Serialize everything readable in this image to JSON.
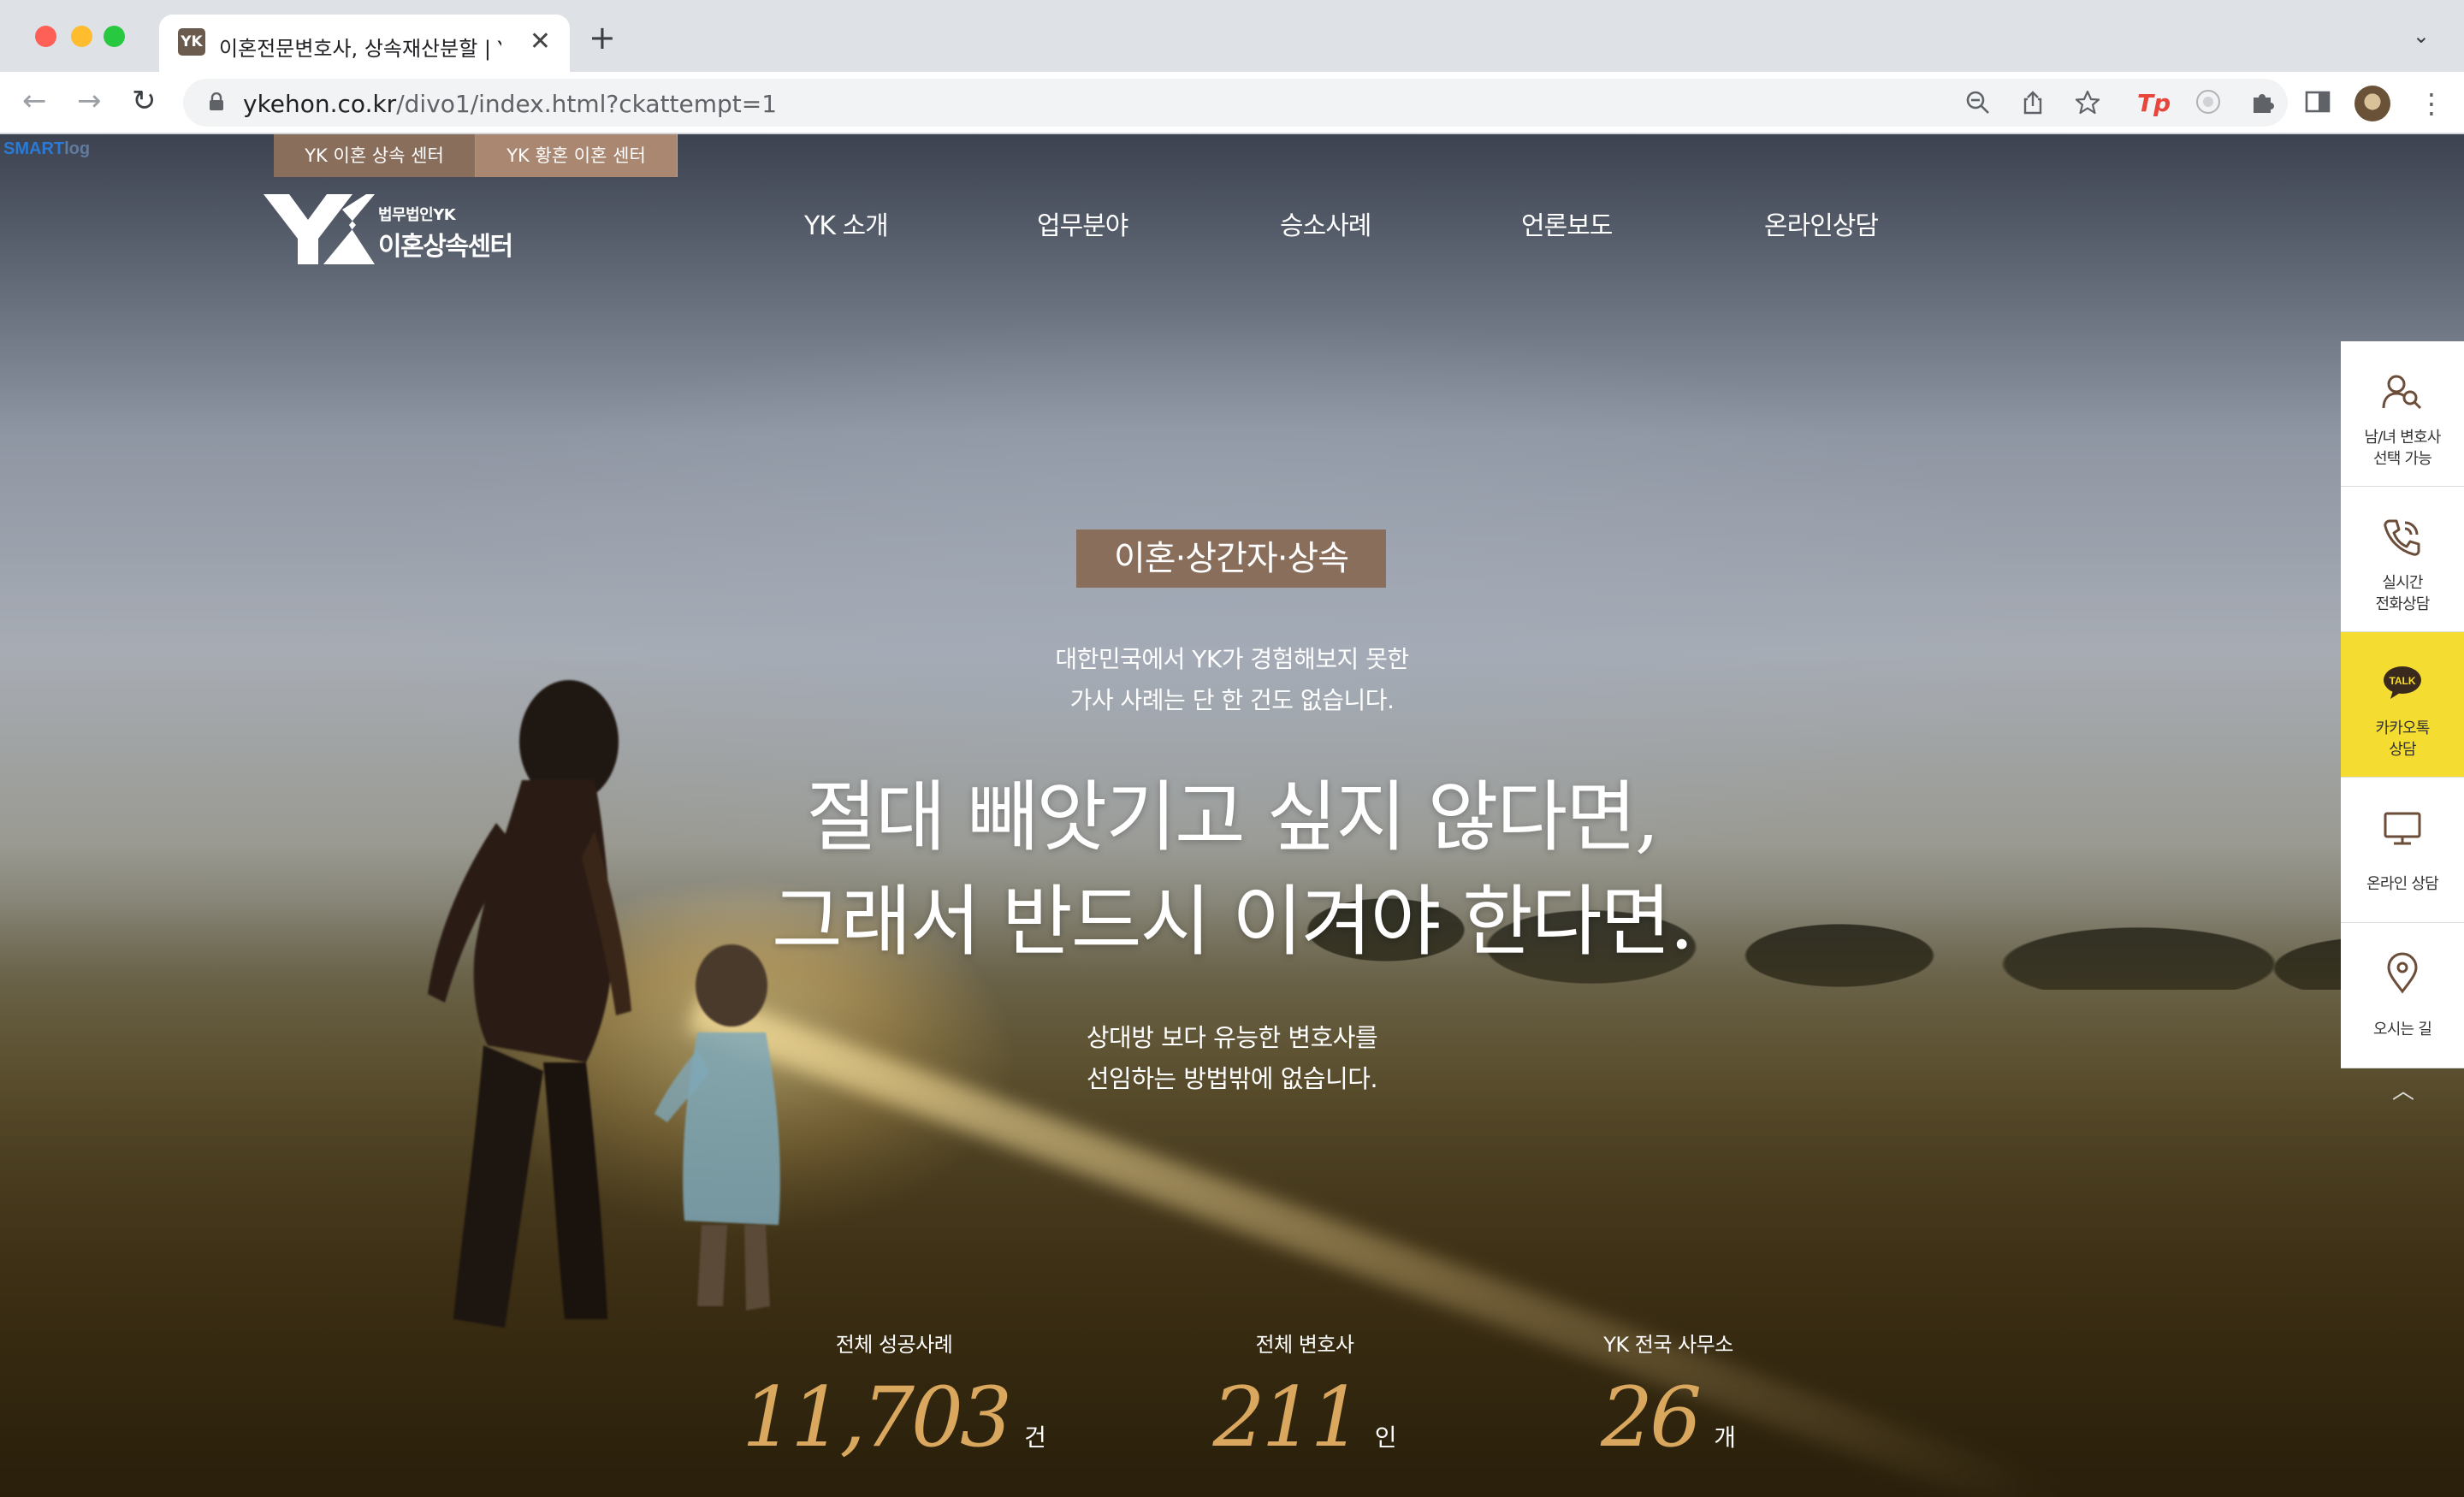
{
  "browser": {
    "tab_title": "이혼전문변호사, 상속재산분할 | YK",
    "close_glyph": "✕",
    "new_tab_glyph": "+",
    "tab_dropdown_glyph": "⌄",
    "url_host": "ykehon.co.kr",
    "url_path": "/divo1/index.html?ckattempt=1",
    "back_glyph": "←",
    "forward_glyph": "→",
    "reload_glyph": "↻",
    "icons": [
      "zoom-out-icon",
      "share-icon",
      "bookmark-star-icon",
      "tp-extension-icon",
      "extension-icon",
      "puzzle-icon",
      "side-panel-icon",
      "profile-avatar",
      "menu-icon"
    ]
  },
  "site": {
    "smart_badge": "SMART",
    "smart_badge_suffix": "log",
    "top_tabs": [
      "YK 이혼 상속 센터",
      "YK 황혼 이혼 센터"
    ],
    "logo": {
      "mark": "YK",
      "subtitle": "법무법인YK",
      "title": "이혼상속센터"
    },
    "nav": [
      "YK 소개",
      "업무분야",
      "승소사례",
      "언론보도",
      "온라인상담"
    ],
    "hero": {
      "tag": "이혼·상간자·상속",
      "intro_line1": "대한민국에서 YK가 경험해보지 못한",
      "intro_line2": "가사 사례는 단 한 건도 없습니다.",
      "title_line1": "절대 빼앗기고 싶지 않다면,",
      "title_line2": "그래서 반드시 이겨야 한다면.",
      "sub_line1": "상대방 보다 유능한 변호사를",
      "sub_line2": "선임하는 방법밖에 없습니다."
    },
    "stats": [
      {
        "label": "전체 성공사례",
        "value": "11,703",
        "unit": "건"
      },
      {
        "label": "전체 변호사",
        "value": "211",
        "unit": "인"
      },
      {
        "label": "YK 전국 사무소",
        "value": "26",
        "unit": "개"
      }
    ],
    "quick_menu": [
      {
        "icon": "lawyer-search-icon",
        "line1": "남/녀 변호사",
        "line2": "선택 가능"
      },
      {
        "icon": "phone-icon",
        "line1": "실시간",
        "line2": "전화상담"
      },
      {
        "icon": "kakao-talk-icon",
        "line1": "카카오톡",
        "line2": "상담",
        "talk_text": "TALK"
      },
      {
        "icon": "monitor-icon",
        "line1": "온라인 상담",
        "line2": ""
      },
      {
        "icon": "map-pin-icon",
        "line1": "오시는 길",
        "line2": ""
      }
    ],
    "scroll_top_glyph": "︿",
    "colors": {
      "brand_brown": "#8a6e5c",
      "stat_gold": "#d9a75e",
      "kakao_yellow": "#f5dc30"
    }
  }
}
